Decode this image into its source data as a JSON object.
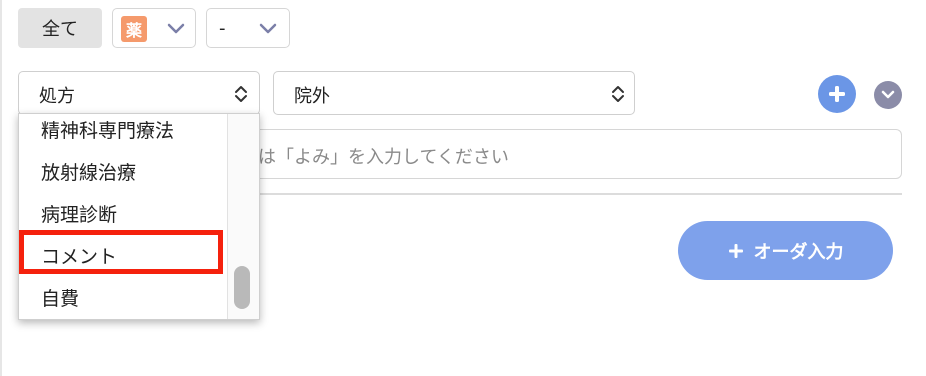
{
  "filters": {
    "all_label": "全て",
    "drug_badge": "薬",
    "dash_value": "-"
  },
  "order_row": {
    "type_value": "処方",
    "place_value": "院外"
  },
  "search": {
    "placeholder_visible": "は「よみ」を入力してください"
  },
  "dropdown": {
    "items": [
      "精神科専門療法",
      "放射線治療",
      "病理診断",
      "コメント",
      "自費"
    ]
  },
  "actions": {
    "order_input_label": "オーダ入力"
  },
  "icons": {
    "plus": "plus-icon",
    "chevron_down": "chevron-down-icon",
    "updown": "select-arrows-icon"
  },
  "colors": {
    "accent_blue": "#6b96e6",
    "order_button": "#7ea1eb",
    "drug_badge": "#f59a6c",
    "highlight": "#f5210d",
    "chevron_circle": "#8b8ca8"
  }
}
